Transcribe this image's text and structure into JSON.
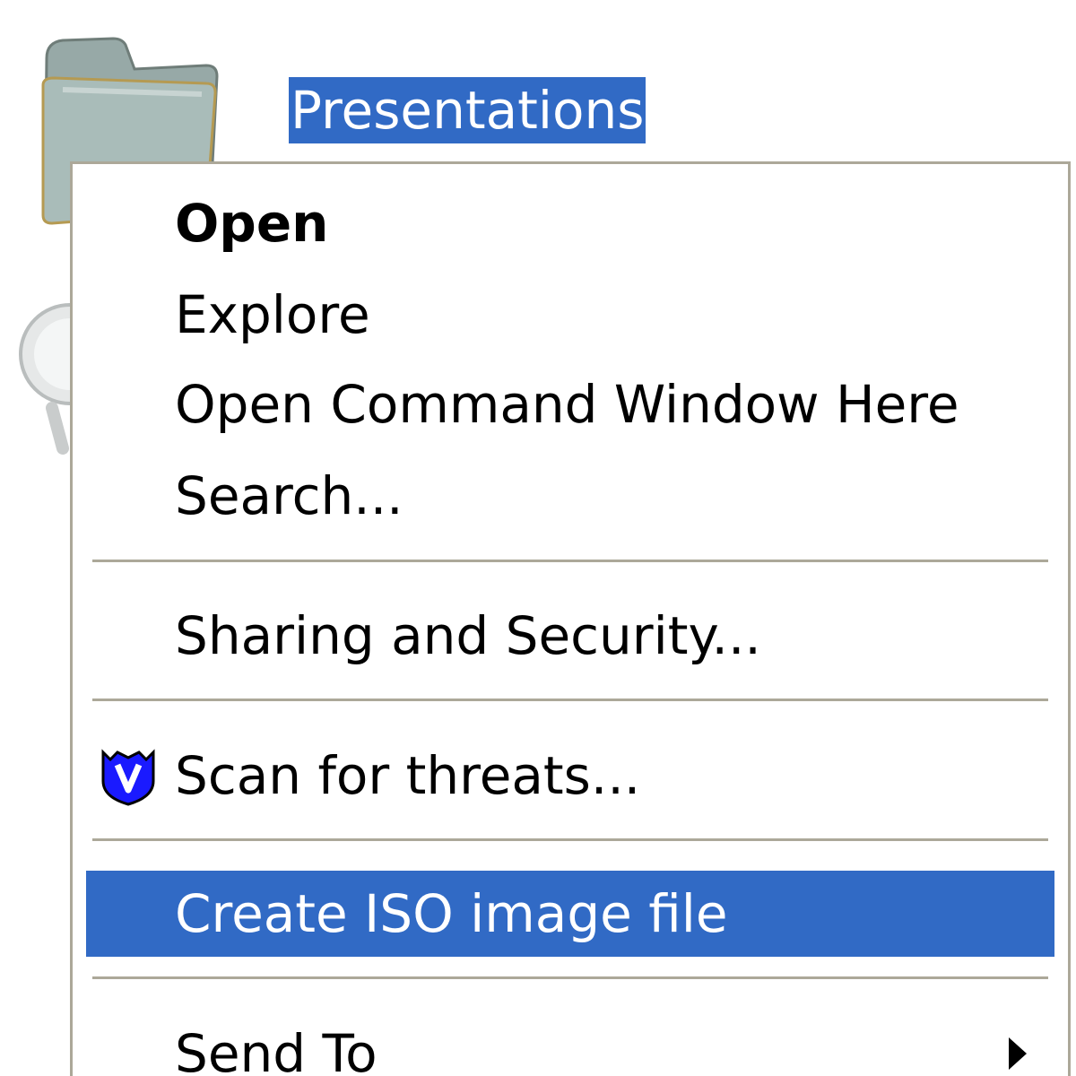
{
  "desktop_item": {
    "label": "Presentations",
    "icon": "folder-icon"
  },
  "background_icon": "magnifier-icon",
  "context_menu": {
    "items": [
      {
        "label": "Open",
        "bold": true
      },
      {
        "label": "Explore"
      },
      {
        "label": "Open Command Window Here"
      },
      {
        "label": "Search..."
      },
      {
        "label": "Sharing and Security..."
      },
      {
        "label": "Scan for threats...",
        "icon": "antivirus-shield-icon"
      },
      {
        "label": "Create ISO image file",
        "highlighted": true
      },
      {
        "label": "Send To",
        "submenu": true,
        "icon": "submenu-arrow-icon"
      }
    ]
  },
  "colors": {
    "selection": "#316ac5",
    "menu_border": "#aca899",
    "shield_blue": "#1a1aff",
    "folder_fill": "#a9bcb9"
  }
}
